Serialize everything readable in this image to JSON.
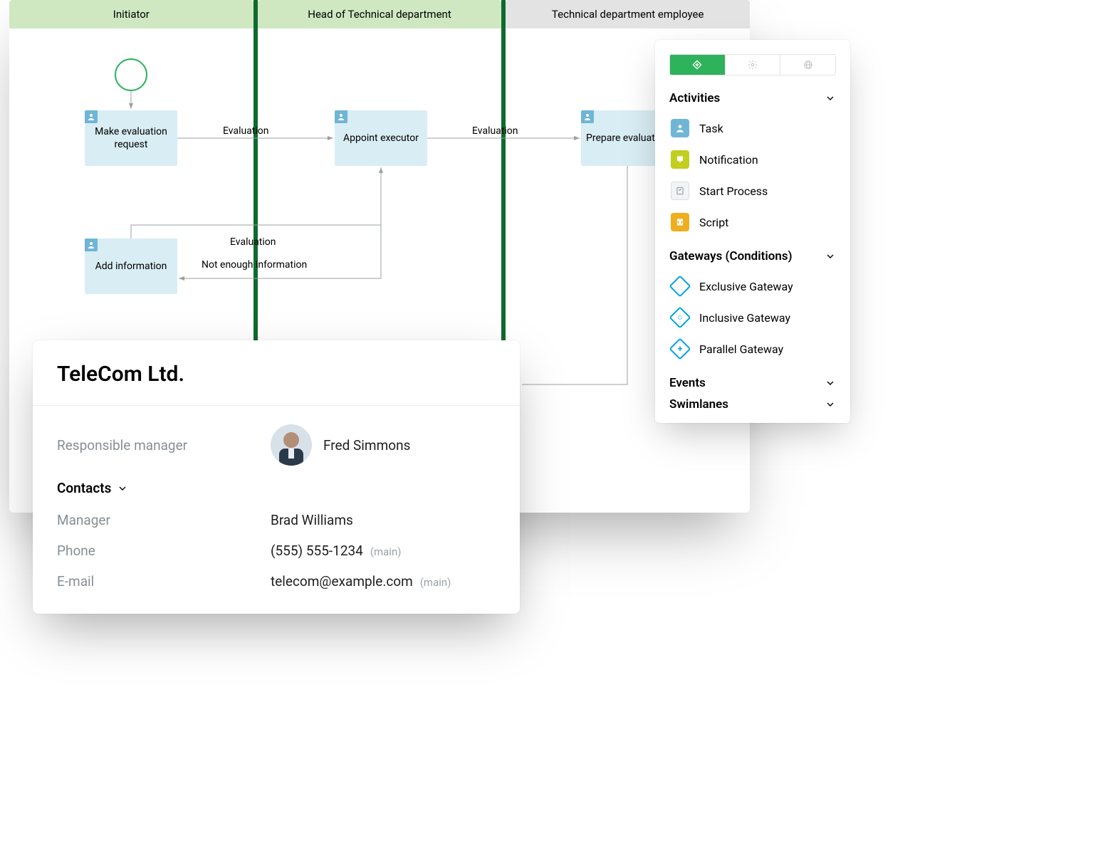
{
  "lanes": [
    {
      "title": "Initiator",
      "style": "green"
    },
    {
      "title": "Head of Technical department",
      "style": "green"
    },
    {
      "title": "Technical department employee",
      "style": "grey"
    }
  ],
  "tasks": {
    "make_request": "Make evaluation request",
    "appoint": "Appoint executor",
    "prepare": "Prepare evaluation",
    "add_info": "Add information"
  },
  "edges": {
    "eval1": "Evaluation",
    "eval2": "Evaluation",
    "eval3": "Evaluation",
    "not_enough": "Not enough information"
  },
  "toolbox": {
    "sections": {
      "activities": "Activities",
      "gateways": "Gateways (Conditions)",
      "events": "Events",
      "swimlanes": "Swimlanes"
    },
    "activities": [
      {
        "label": "Task",
        "icon": "task"
      },
      {
        "label": "Notification",
        "icon": "notification"
      },
      {
        "label": "Start Process",
        "icon": "start-process"
      },
      {
        "label": "Script",
        "icon": "script"
      }
    ],
    "gateways": [
      {
        "label": "Exclusive Gateway"
      },
      {
        "label": "Inclusive Gateway"
      },
      {
        "label": "Parallel Gateway"
      }
    ]
  },
  "card": {
    "title": "TeleCom Ltd.",
    "fields": {
      "responsible_label": "Responsible manager",
      "responsible_value": "Fred Simmons",
      "contacts_section": "Contacts",
      "manager_label": "Manager",
      "manager_value": "Brad Williams",
      "phone_label": "Phone",
      "phone_value": "(555) 555-1234",
      "phone_hint": "(main)",
      "email_label": "E-mail",
      "email_value": "telecom@example.com",
      "email_hint": "(main)"
    }
  },
  "colors": {
    "accent_green": "#2eb25c",
    "task_blue": "#d9edf4",
    "link_blue": "#136291",
    "gateway_cyan": "#00a3e0"
  }
}
